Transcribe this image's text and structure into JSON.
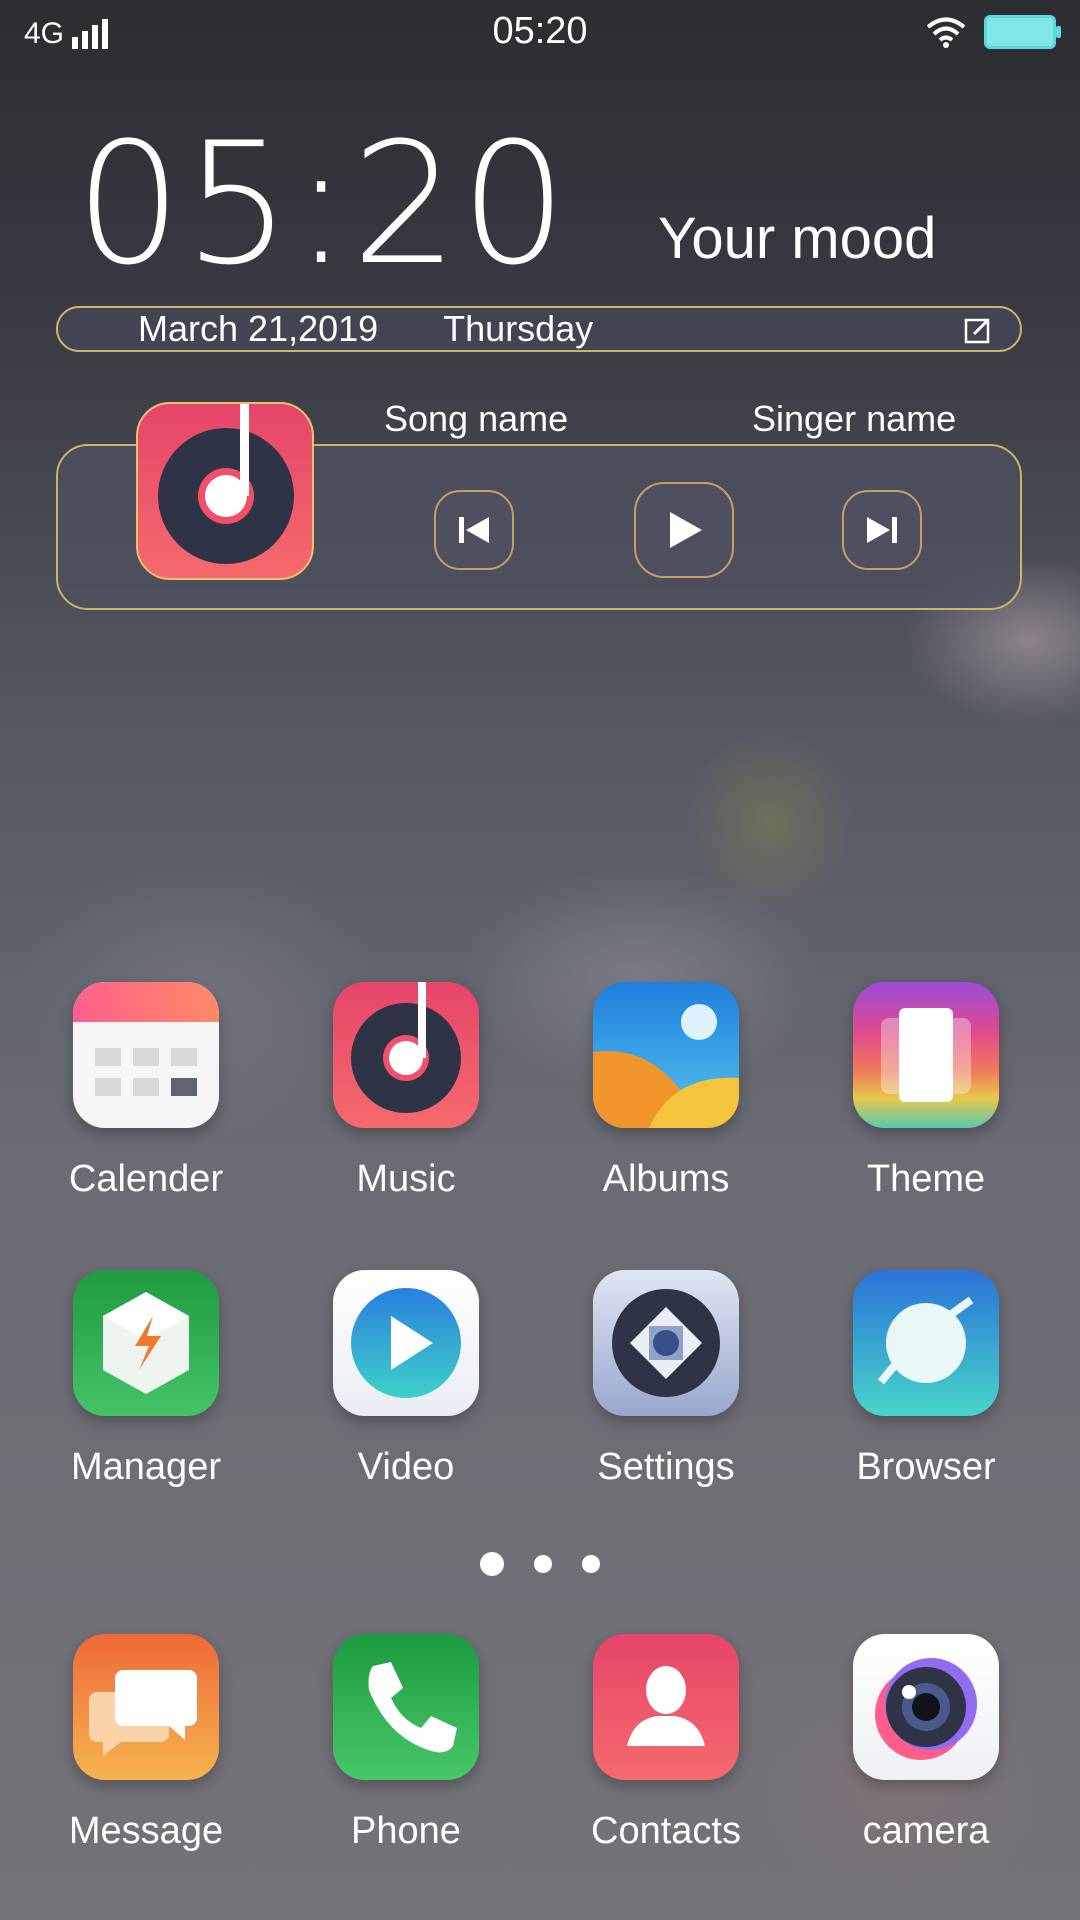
{
  "status_bar": {
    "network": "4G",
    "time": "05:20"
  },
  "clock_widget": {
    "time": "05:20",
    "mood": "Your mood",
    "date": "March 21,2019",
    "weekday": "Thursday"
  },
  "music_widget": {
    "song": "Song name",
    "singer": "Singer name"
  },
  "apps_page": [
    {
      "label": "Calender",
      "icon": "calendar-icon"
    },
    {
      "label": "Music",
      "icon": "music-icon"
    },
    {
      "label": "Albums",
      "icon": "albums-icon"
    },
    {
      "label": "Theme",
      "icon": "theme-icon"
    },
    {
      "label": "Manager",
      "icon": "manager-icon"
    },
    {
      "label": "Video",
      "icon": "video-icon"
    },
    {
      "label": "Settings",
      "icon": "settings-icon"
    },
    {
      "label": "Browser",
      "icon": "browser-icon"
    }
  ],
  "page_indicator": {
    "pages": 3,
    "current": 1
  },
  "dock": [
    {
      "label": "Message",
      "icon": "message-icon"
    },
    {
      "label": "Phone",
      "icon": "phone-icon"
    },
    {
      "label": "Contacts",
      "icon": "contacts-icon"
    },
    {
      "label": "camera",
      "icon": "camera-icon"
    }
  ],
  "colors": {
    "widget_border": "#c9b46a",
    "battery": "#7ee9e6",
    "music_red": "#f0506a"
  }
}
